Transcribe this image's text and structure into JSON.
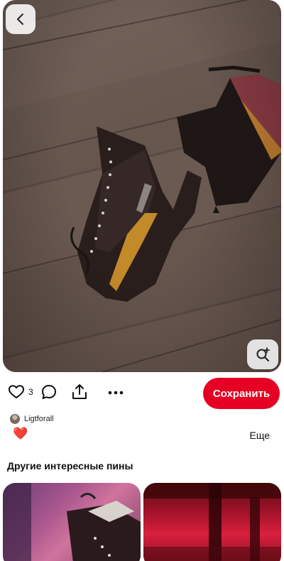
{
  "pin": {
    "image_description_icon": "shoe-photo",
    "back_icon": "chevron-left-icon",
    "visual_search_icon": "visual-search-icon"
  },
  "actions": {
    "like_count": "3",
    "save_label": "Сохранить"
  },
  "author": {
    "name": "Ligtforall"
  },
  "description": {
    "emoji": "❤️",
    "more_label": "Еще"
  },
  "related": {
    "title": "Другие интересные пины"
  },
  "colors": {
    "save_button": "#e60023",
    "background": "#ffffff"
  }
}
